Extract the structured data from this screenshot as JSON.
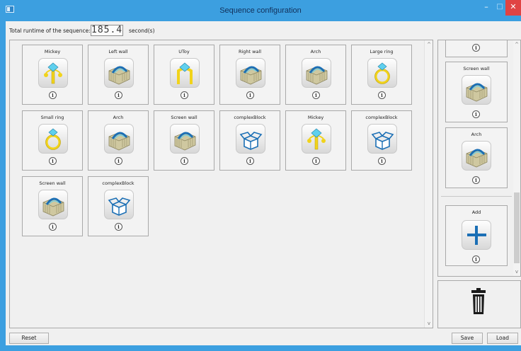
{
  "window": {
    "title": "Sequence configuration"
  },
  "runtime": {
    "label": "Total runtime of the sequence:",
    "value": "185.4",
    "unit": "second(s)"
  },
  "sequence": [
    {
      "name": "Mickey",
      "icon": "mickey-icon"
    },
    {
      "name": "Left wall",
      "icon": "wall-icon"
    },
    {
      "name": "UToy",
      "icon": "utoy-icon"
    },
    {
      "name": "Right wall",
      "icon": "wall-icon"
    },
    {
      "name": "Arch",
      "icon": "wall-icon"
    },
    {
      "name": "Large ring",
      "icon": "ring-icon"
    },
    {
      "name": "Small ring",
      "icon": "ring-icon"
    },
    {
      "name": "Arch",
      "icon": "wall-icon"
    },
    {
      "name": "Screen wall",
      "icon": "wall-icon"
    },
    {
      "name": "complexBlock",
      "icon": "box-icon"
    },
    {
      "name": "Mickey",
      "icon": "mickey-icon"
    },
    {
      "name": "complexBlock",
      "icon": "box-icon"
    },
    {
      "name": "Screen wall",
      "icon": "wall-icon"
    },
    {
      "name": "complexBlock",
      "icon": "box-icon"
    }
  ],
  "palette": [
    {
      "name": "",
      "icon": "wall-icon"
    },
    {
      "name": "Screen wall",
      "icon": "wall-icon"
    },
    {
      "name": "Arch",
      "icon": "wall-icon"
    }
  ],
  "add_tile": {
    "name": "Add",
    "icon": "plus-icon"
  },
  "info_glyph": "i",
  "buttons": {
    "reset": "Reset",
    "save": "Save",
    "load": "Load"
  },
  "window_controls": {
    "minimize": "–",
    "maximize": "□",
    "close": "✕"
  },
  "scroll_glyphs": {
    "up": "^",
    "down": "v"
  },
  "colors": {
    "titlebar": "#3c9fe0",
    "close": "#e04343",
    "accent_blue": "#1b6fb5",
    "toy_yellow": "#f1d31a",
    "toy_cyan": "#5fd0ee"
  }
}
